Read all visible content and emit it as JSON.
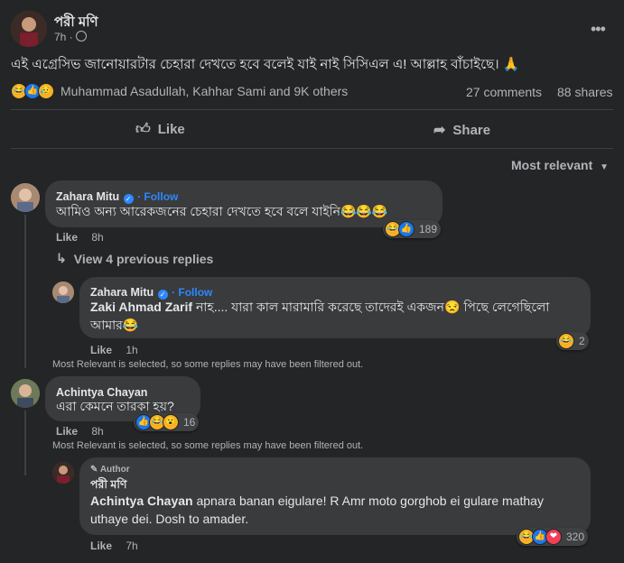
{
  "post": {
    "author": "পরী মণি",
    "time": "7h ·",
    "globe_icon": "globe-icon",
    "more_icon": "more-dots-icon",
    "text": "এই এগ্রেসিভ জানোয়ারটার চেহারা দেখতে হবে বলেই যাই নাই সিসিএল এ! আল্লাহ বাঁচাইছে। 🙏",
    "reactions_summary": "Muhammad Asadullah, Kahhar Sami and 9K others",
    "comments_count": "27 comments",
    "shares_count": "88 shares",
    "actions": {
      "like": "Like",
      "share": "Share"
    },
    "sort_label": "Most relevant"
  },
  "comments": [
    {
      "name": "Zahara Mitu",
      "follow": "· Follow",
      "text": "আমিও অন্য আরেকজনের চেহারা দেখতে হবে বলে যাইনি😂😂😂",
      "like": "Like",
      "time": "8h",
      "reaction_count": "189"
    },
    {
      "view_replies": "View 4 previous replies"
    },
    {
      "name": "Zahara Mitu",
      "follow": "· Follow",
      "text_tag": "Zaki Ahmad Zarif",
      "text": " নাহ.... যারা কাল মারামারি করেছে তাদেরই একজন😒 পিছে লেগেছিলো আমার😂",
      "like": "Like",
      "time": "1h",
      "reaction_count": "2",
      "filter_note": "Most Relevant is selected, so some replies may have been filtered out."
    },
    {
      "name": "Achintya Chayan",
      "text": "এরা কেমনে তারকা হয়?",
      "like": "Like",
      "time": "8h",
      "reaction_count": "16",
      "filter_note": "Most Relevant is selected, so some replies may have been filtered out."
    },
    {
      "author_badge": "Author",
      "name": "পরী মণি",
      "text_tag": "Achintya Chayan",
      "text": " apnara banan eigulare! R Amr moto gorghob ei gulare mathay uthaye dei. Dosh to amader.",
      "like": "Like",
      "time": "7h",
      "reaction_count": "320"
    }
  ]
}
